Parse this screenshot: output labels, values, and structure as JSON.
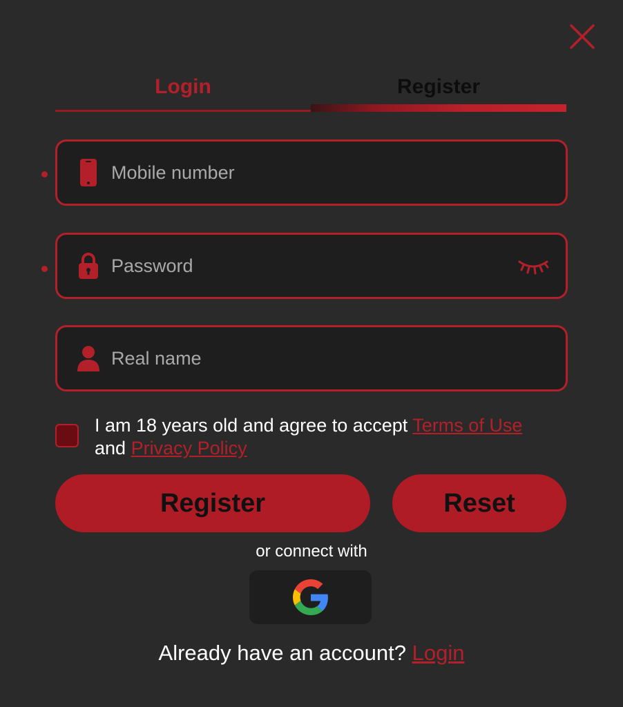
{
  "tabs": {
    "login_label": "Login",
    "register_label": "Register",
    "active": "register"
  },
  "form": {
    "mobile": {
      "placeholder": "Mobile number",
      "value": "",
      "icon": "mobile-phone-icon",
      "required": true
    },
    "password": {
      "placeholder": "Password",
      "value": "",
      "icon": "lock-icon",
      "toggle_icon": "eye-closed-icon",
      "required": true
    },
    "real_name": {
      "placeholder": "Real name",
      "value": "",
      "icon": "user-icon",
      "required": false
    }
  },
  "agreement": {
    "text_before": "I am 18 years old and agree to accept ",
    "terms_link": "Terms of Use",
    "text_middle": " and ",
    "privacy_link": "Privacy Policy"
  },
  "buttons": {
    "register_label": "Register",
    "reset_label": "Reset"
  },
  "social": {
    "connect_text": "or connect with",
    "google_icon": "google-icon"
  },
  "footer": {
    "prompt": "Already have an account? ",
    "login_link": "Login"
  },
  "colors": {
    "background": "#2a2a2a",
    "accent": "#b3202a",
    "field_bg": "#1e1e1e",
    "button_bg": "#b01c26"
  }
}
